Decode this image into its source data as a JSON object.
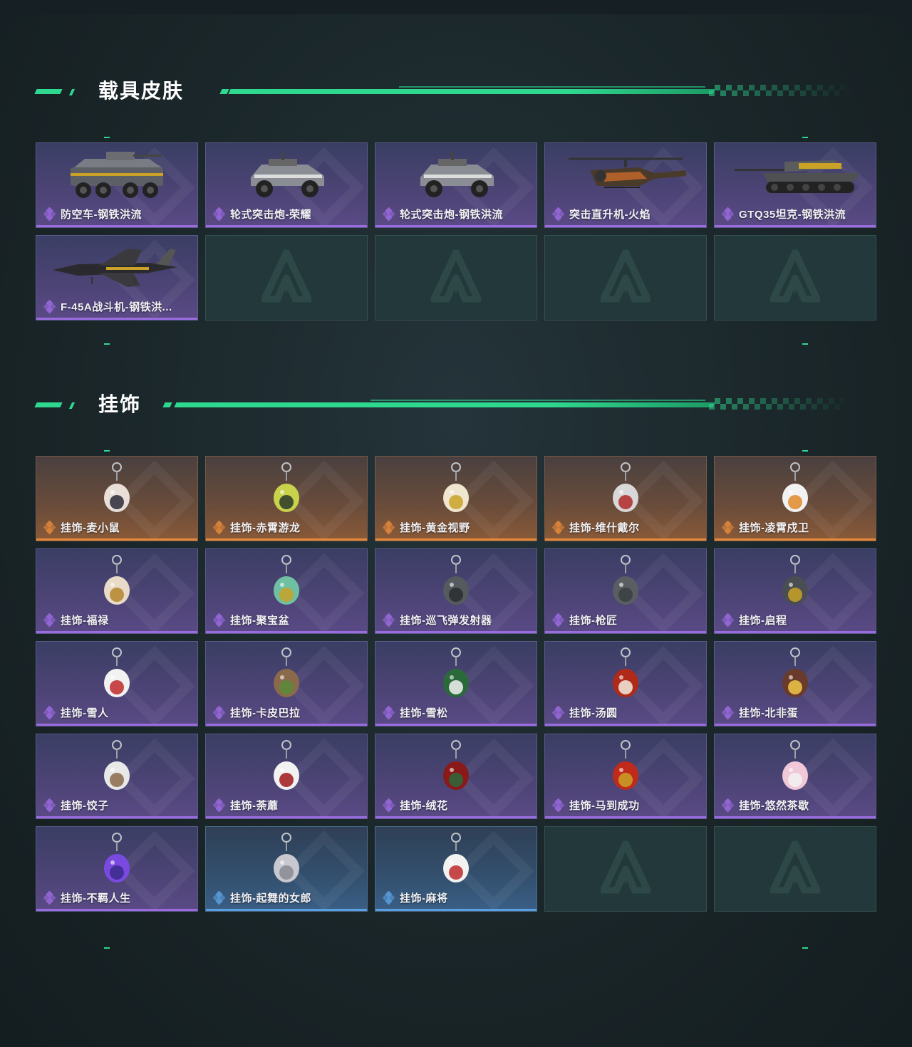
{
  "sections": {
    "vehicle": {
      "title": "载具皮肤",
      "items": [
        {
          "label": "防空车-钢铁洪流",
          "rarity": "purple",
          "icon": "armored-vehicle-icon"
        },
        {
          "label": "轮式突击炮-荣耀",
          "rarity": "purple",
          "icon": "buggy-vehicle-icon"
        },
        {
          "label": "轮式突击炮-钢铁洪流",
          "rarity": "purple",
          "icon": "buggy-vehicle-icon"
        },
        {
          "label": "突击直升机-火焰",
          "rarity": "purple",
          "icon": "helicopter-icon"
        },
        {
          "label": "GTQ35坦克-钢铁洪流",
          "rarity": "purple",
          "icon": "tank-icon"
        },
        {
          "label": "F-45A战斗机-钢铁洪...",
          "rarity": "purple",
          "icon": "jet-fighter-icon"
        }
      ],
      "empty_slots": 4
    },
    "pendant": {
      "title": "挂饰",
      "items": [
        {
          "label": "挂饰-麦小鼠",
          "rarity": "orange",
          "icon": "mouse-figure-icon"
        },
        {
          "label": "挂饰-赤霄游龙",
          "rarity": "orange",
          "icon": "dragon-figure-icon"
        },
        {
          "label": "挂饰-黄金视野",
          "rarity": "orange",
          "icon": "golden-figure-icon"
        },
        {
          "label": "挂饰-维什戴尔",
          "rarity": "orange",
          "icon": "tag-pendant-icon"
        },
        {
          "label": "挂饰-凌霄戍卫",
          "rarity": "orange",
          "icon": "bird-figure-icon"
        },
        {
          "label": "挂饰-福禄",
          "rarity": "purple",
          "icon": "gourd-pendant-icon"
        },
        {
          "label": "挂饰-聚宝盆",
          "rarity": "purple",
          "icon": "treasure-bowl-icon"
        },
        {
          "label": "挂饰-巡飞弹发射器",
          "rarity": "purple",
          "icon": "launcher-pendant-icon"
        },
        {
          "label": "挂饰-枪匠",
          "rarity": "purple",
          "icon": "gunsmith-pendant-icon"
        },
        {
          "label": "挂饰-启程",
          "rarity": "purple",
          "icon": "emblem-pendant-icon"
        },
        {
          "label": "挂饰-雪人",
          "rarity": "purple",
          "icon": "snowman-pendant-icon"
        },
        {
          "label": "挂饰-卡皮巴拉",
          "rarity": "purple",
          "icon": "capybara-pendant-icon"
        },
        {
          "label": "挂饰-雪松",
          "rarity": "purple",
          "icon": "pine-tree-pendant-icon"
        },
        {
          "label": "挂饰-汤圆",
          "rarity": "purple",
          "icon": "rice-ball-pendant-icon"
        },
        {
          "label": "挂饰-北非蛋",
          "rarity": "purple",
          "icon": "shakshuka-pendant-icon"
        },
        {
          "label": "挂饰-饺子",
          "rarity": "purple",
          "icon": "dumpling-pendant-icon"
        },
        {
          "label": "挂饰-荼蘼",
          "rarity": "purple",
          "icon": "flower-figure-pendant-icon"
        },
        {
          "label": "挂饰-绒花",
          "rarity": "purple",
          "icon": "velvet-flower-pendant-icon"
        },
        {
          "label": "挂饰-马到成功",
          "rarity": "purple",
          "icon": "horse-pendant-icon"
        },
        {
          "label": "挂饰-悠然茶歇",
          "rarity": "purple",
          "icon": "cupcake-pendant-icon"
        },
        {
          "label": "挂饰-不羁人生",
          "rarity": "purple",
          "icon": "sneaker-pendant-icon"
        },
        {
          "label": "挂饰-起舞的女郎",
          "rarity": "blue",
          "icon": "dancer-pendant-icon"
        },
        {
          "label": "挂饰-麻将",
          "rarity": "blue",
          "icon": "mahjong-pendant-icon"
        }
      ],
      "empty_slots": 2
    }
  },
  "colors": {
    "accent": "#2fd88f",
    "purple": "#9b6be0",
    "orange": "#e58a3a",
    "blue": "#5aa0e0"
  }
}
